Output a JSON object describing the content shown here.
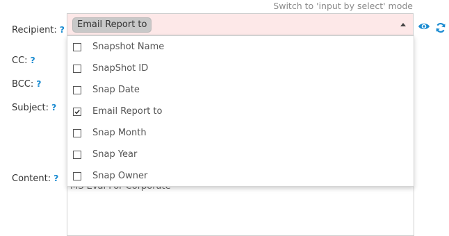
{
  "switch_mode_link": "Switch to 'input by select' mode",
  "labels": {
    "recipient": "Recipient:",
    "cc": "CC:",
    "bcc": "BCC:",
    "subject": "Subject:",
    "content": "Content:",
    "help": "?"
  },
  "recipient": {
    "selected_tag": "Email Report to"
  },
  "dropdown_options": [
    {
      "label": "Snapshot Name",
      "checked": false
    },
    {
      "label": "SnapShot ID",
      "checked": false
    },
    {
      "label": "Snap Date",
      "checked": false
    },
    {
      "label": "Email Report to",
      "checked": true
    },
    {
      "label": "Snap Month",
      "checked": false
    },
    {
      "label": "Snap Year",
      "checked": false
    },
    {
      "label": "Snap Owner",
      "checked": false
    }
  ],
  "content_value": "MS Eval For Corporate",
  "colors": {
    "accent": "#1a8bd1",
    "recipient_bg": "#fde8e8",
    "tag_bg": "#c8c8c8"
  },
  "icons": [
    "eye-icon",
    "refresh-icon",
    "caret-up-icon",
    "checkmark-icon"
  ]
}
